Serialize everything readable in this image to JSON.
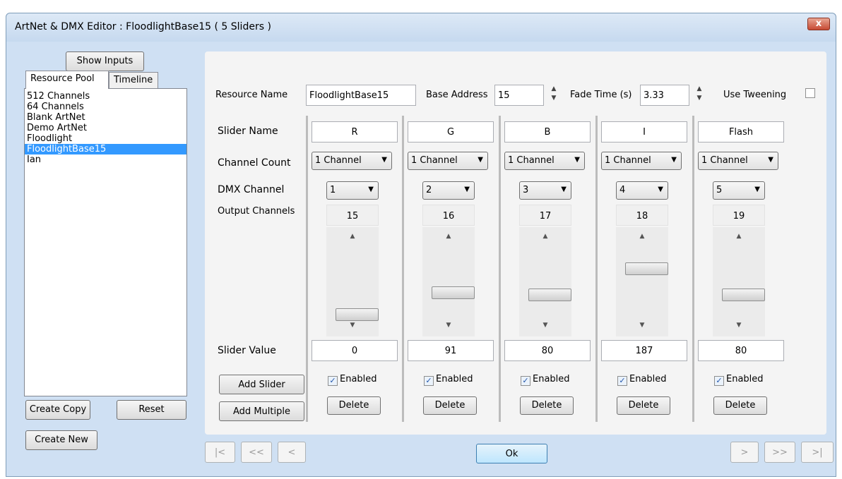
{
  "window": {
    "title": "ArtNet & DMX Editor : FloodlightBase15 ( 5 Sliders )",
    "close_label": "x"
  },
  "left": {
    "show_inputs": "Show Inputs",
    "tabs": [
      {
        "label": "Resource Pool"
      },
      {
        "label": "Timeline"
      }
    ],
    "pool": [
      {
        "label": "512 Channels"
      },
      {
        "label": "64 Channels"
      },
      {
        "label": "Blank ArtNet"
      },
      {
        "label": "Demo ArtNet"
      },
      {
        "label": "Floodlight"
      },
      {
        "label": "FloodlightBase15",
        "selected": true
      },
      {
        "label": "Ian"
      }
    ],
    "create_copy": "Create Copy",
    "reset": "Reset",
    "create_new": "Create New"
  },
  "header": {
    "resource_name_label": "Resource Name",
    "resource_name_value": "FloodlightBase15",
    "base_address_label": "Base Address",
    "base_address_value": "15",
    "fade_time_label": "Fade Time (s)",
    "fade_time_value": "3.33",
    "use_tweening_label": "Use Tweening",
    "use_tweening_checked": false
  },
  "row_labels": {
    "slider_name": "Slider Name",
    "channel_count": "Channel Count",
    "dmx_channel": "DMX Channel",
    "output_channels": "Output Channels",
    "slider_value": "Slider Value"
  },
  "actions": {
    "add_slider": "Add Slider",
    "add_multiple": "Add Multiple"
  },
  "sliders": [
    {
      "name": "R",
      "channel_count": "1 Channel",
      "dmx_channel": "1",
      "output": "15",
      "value": "0",
      "level": 0.0,
      "enabled_label": "Enabled",
      "enabled": true,
      "delete_label": "Delete"
    },
    {
      "name": "G",
      "channel_count": "1 Channel",
      "dmx_channel": "2",
      "output": "16",
      "value": "91",
      "level": 0.357,
      "enabled_label": "Enabled",
      "enabled": true,
      "delete_label": "Delete"
    },
    {
      "name": "B",
      "channel_count": "1 Channel",
      "dmx_channel": "3",
      "output": "17",
      "value": "80",
      "level": 0.314,
      "enabled_label": "Enabled",
      "enabled": true,
      "delete_label": "Delete"
    },
    {
      "name": "I",
      "channel_count": "1 Channel",
      "dmx_channel": "4",
      "output": "18",
      "value": "187",
      "level": 0.733,
      "enabled_label": "Enabled",
      "enabled": true,
      "delete_label": "Delete"
    },
    {
      "name": "Flash",
      "channel_count": "1 Channel",
      "dmx_channel": "5",
      "output": "19",
      "value": "80",
      "level": 0.314,
      "enabled_label": "Enabled",
      "enabled": true,
      "delete_label": "Delete"
    }
  ],
  "nav": {
    "first": "|<",
    "prev_page": "<<",
    "prev": "<",
    "ok": "Ok",
    "next": ">",
    "next_page": ">>",
    "last": ">|"
  }
}
